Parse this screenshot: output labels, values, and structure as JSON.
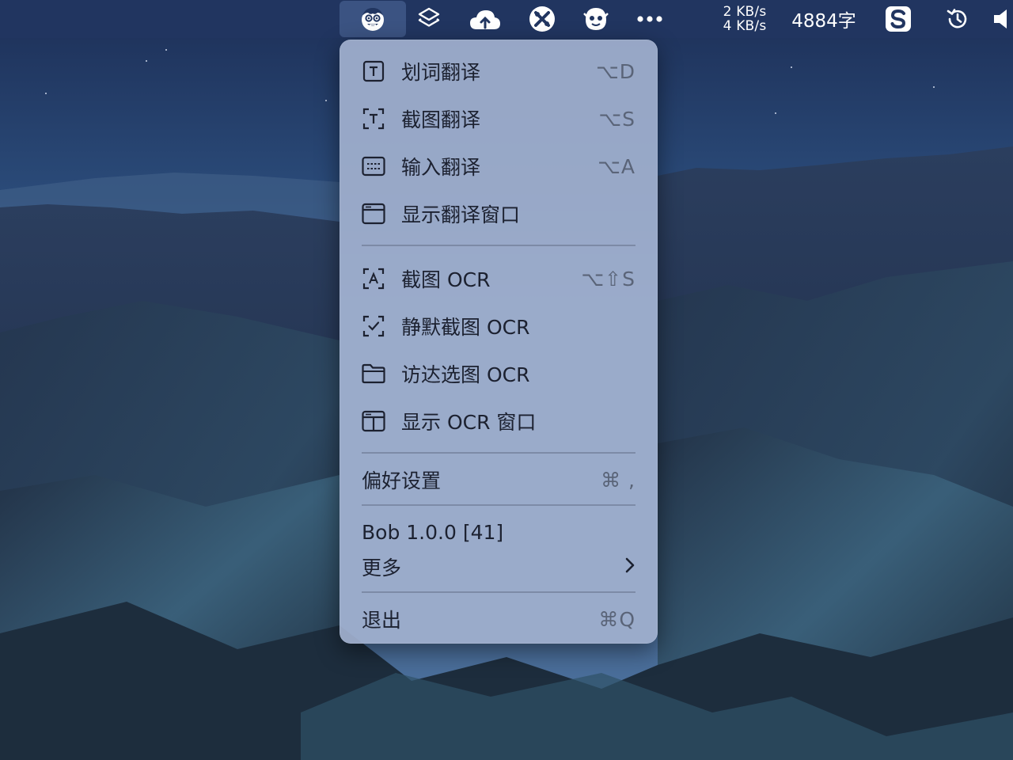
{
  "menubar": {
    "network": {
      "upload": "2 KB/s",
      "download": "4 KB/s"
    },
    "word_count": "4884字",
    "icons": [
      "bob-app-icon",
      "layers-icon",
      "cloud-upload-icon",
      "tools-icon",
      "ghost-icon",
      "more-icon",
      "sogou-input-icon",
      "time-machine-icon",
      "volume-icon"
    ]
  },
  "menu": {
    "items": [
      {
        "label": "划词翻译",
        "shortcut": "⌥D",
        "icon": "text-box-icon"
      },
      {
        "label": "截图翻译",
        "shortcut": "⌥S",
        "icon": "screenshot-text-icon"
      },
      {
        "label": "输入翻译",
        "shortcut": "⌥A",
        "icon": "keyboard-icon"
      },
      {
        "label": "显示翻译窗口",
        "shortcut": "",
        "icon": "window-icon"
      },
      {
        "label": "截图 OCR",
        "shortcut": "⌥⇧S",
        "icon": "screenshot-ocr-icon"
      },
      {
        "label": "静默截图 OCR",
        "shortcut": "",
        "icon": "silent-screenshot-icon"
      },
      {
        "label": "访达选图 OCR",
        "shortcut": "",
        "icon": "folder-icon"
      },
      {
        "label": "显示 OCR 窗口",
        "shortcut": "",
        "icon": "ocr-window-icon"
      },
      {
        "label": "偏好设置",
        "shortcut": "⌘ ,",
        "icon": ""
      }
    ],
    "version": "Bob 1.0.0 [41]",
    "more_label": "更多",
    "quit": {
      "label": "退出",
      "shortcut": "⌘Q"
    }
  },
  "colors": {
    "menubar_bg": "#213560",
    "menu_bg": "#a0afcd",
    "active_icon_bg": "#3b5382"
  }
}
